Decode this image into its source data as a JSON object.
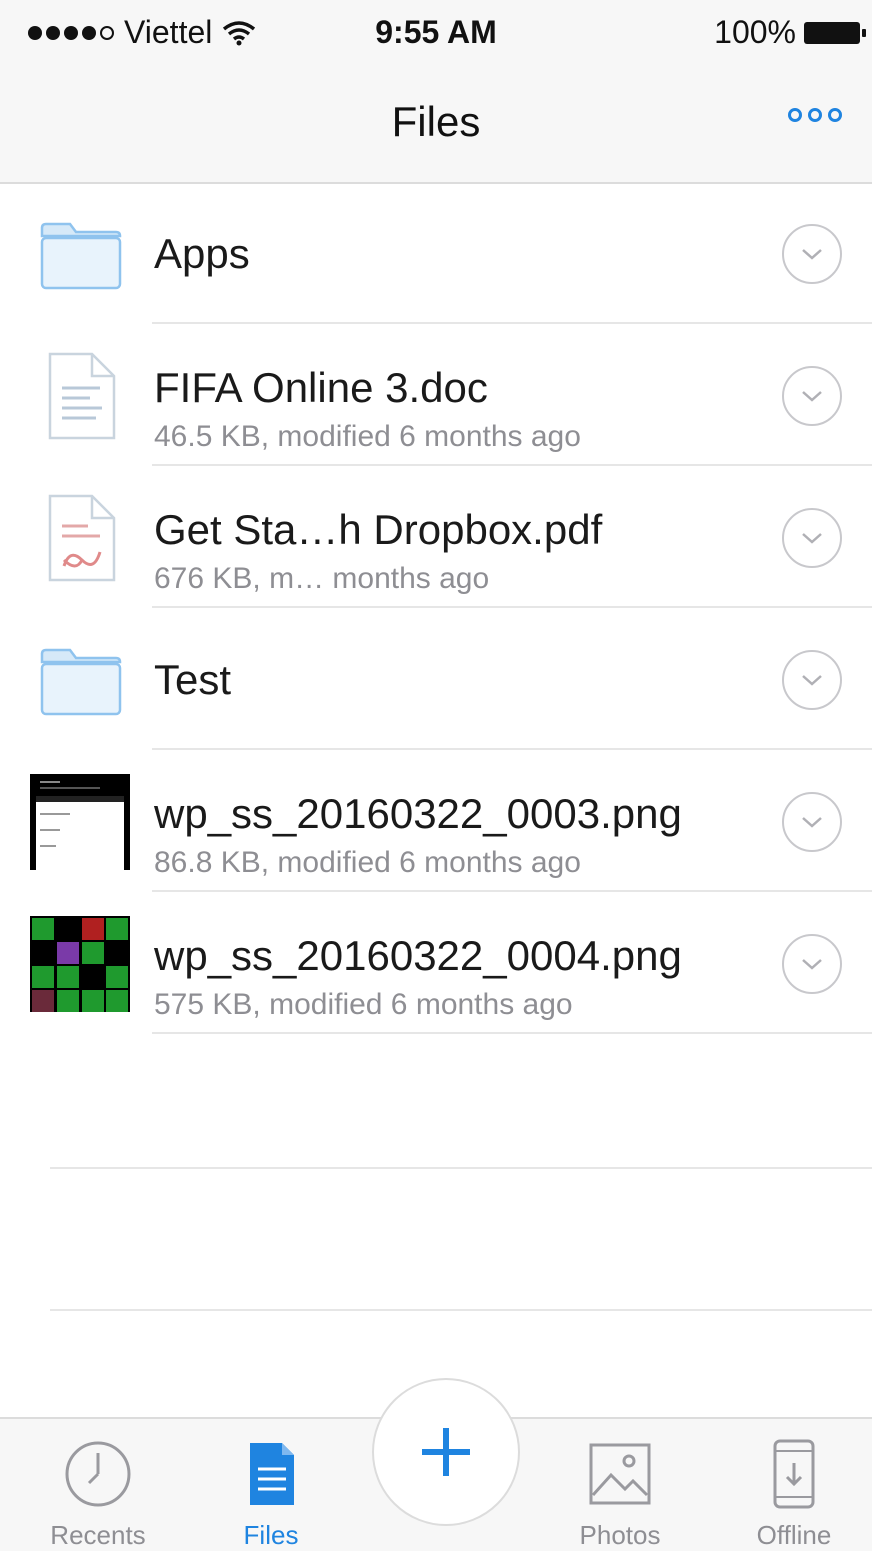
{
  "status_bar": {
    "carrier": "Viettel",
    "time": "9:55 AM",
    "battery": "100%"
  },
  "nav": {
    "title": "Files",
    "more_icon": "more-dots-icon"
  },
  "files": [
    {
      "name": "Apps",
      "meta": "",
      "type": "folder",
      "icon": "folder-icon"
    },
    {
      "name": "FIFA Online 3.doc",
      "meta": "46.5 KB, modified 6 months ago",
      "type": "doc",
      "icon": "document-icon"
    },
    {
      "name": "Get Sta…h Dropbox.pdf",
      "meta": "676 KB, m… months ago",
      "type": "pdf",
      "icon": "pdf-icon"
    },
    {
      "name": "Test",
      "meta": "",
      "type": "folder",
      "icon": "folder-icon"
    },
    {
      "name": "wp_ss_20160322_0003.png",
      "meta": "86.8 KB, modified 6 months ago",
      "type": "image",
      "icon": "image-thumbnail"
    },
    {
      "name": "wp_ss_20160322_0004.png",
      "meta": "575 KB, modified 6 months ago",
      "type": "image",
      "icon": "image-thumbnail"
    }
  ],
  "tabs": [
    {
      "label": "Recents",
      "icon": "clock-icon",
      "active": false
    },
    {
      "label": "Files",
      "icon": "files-icon",
      "active": true
    },
    {
      "label": "Photos",
      "icon": "photos-icon",
      "active": false
    },
    {
      "label": "Offline",
      "icon": "offline-icon",
      "active": false
    }
  ],
  "fab": {
    "icon": "plus-icon"
  },
  "colors": {
    "accent": "#1f84e0",
    "folder": "#8fc3ee",
    "secondary_text": "#8e8e93"
  }
}
